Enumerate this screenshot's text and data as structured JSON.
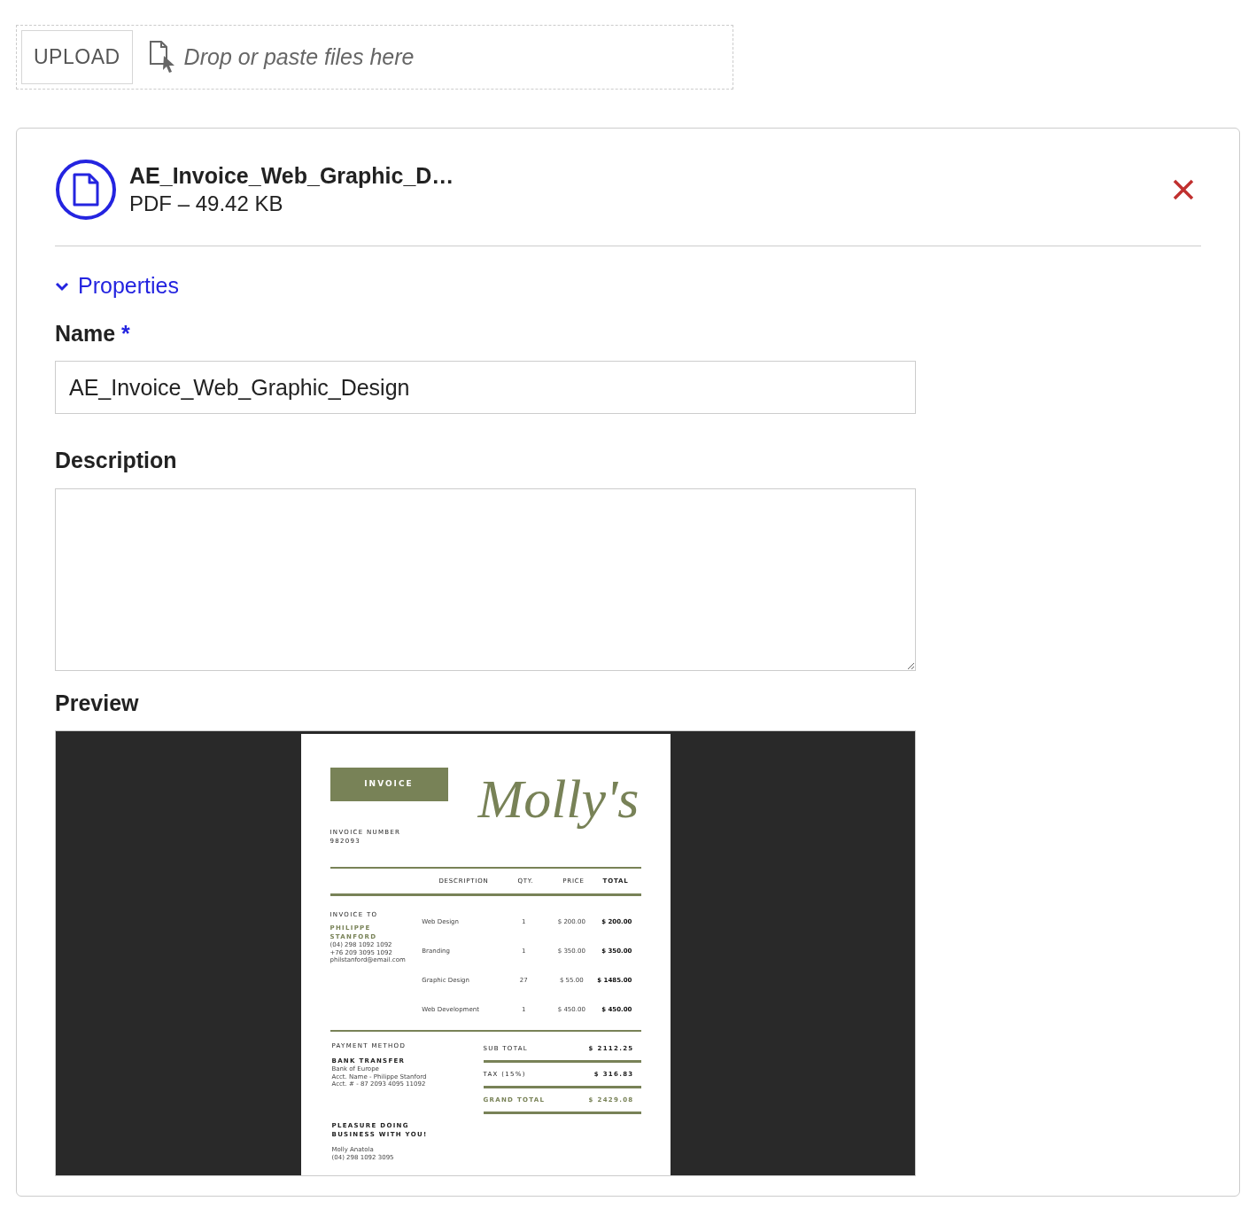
{
  "upload": {
    "button": "UPLOAD",
    "hint": "Drop or paste files here"
  },
  "file": {
    "name": "AE_Invoice_Web_Graphic_D…",
    "meta": "PDF – 49.42 KB"
  },
  "properties": {
    "label": "Properties",
    "expanded": true
  },
  "fields": [
    {
      "kind": "input",
      "label": "Name",
      "required_mark": "*",
      "value": "AE_Invoice_Web_Graphic_Design"
    },
    {
      "kind": "textarea",
      "label": "Description"
    }
  ],
  "preview": {
    "label": "Preview",
    "document": {
      "banner": "INVOICE",
      "logo": "Molly's",
      "number_label": "INVOICE NUMBER",
      "number": "982093",
      "columns": [
        "DESCRIPTION",
        "QTY.",
        "PRICE",
        "TOTAL"
      ],
      "bill_to_label": "INVOICE TO",
      "client_name": "PHILIPPE STANFORD",
      "client_lines": [
        "(04) 298 1092 1092",
        "+76 209 3095 1092",
        "philstanford@email.com"
      ],
      "rows": [
        {
          "description": "Web Design",
          "qty": "1",
          "price": "$ 200.00",
          "total": "$ 200.00"
        },
        {
          "description": "Branding",
          "qty": "1",
          "price": "$ 350.00",
          "total": "$ 350.00"
        },
        {
          "description": "Graphic Design",
          "qty": "27",
          "price": "$ 55.00",
          "total": "$ 1485.00"
        },
        {
          "description": "Web Development",
          "qty": "1",
          "price": "$ 450.00",
          "total": "$ 450.00"
        }
      ],
      "payment_label": "PAYMENT METHOD",
      "payment_method": "BANK TRANSFER",
      "payment_lines": [
        "Bank of Europe",
        "Acct. Name - Philippe Stanford",
        "Acct. # - 87 2093 4095 11092"
      ],
      "totals": [
        {
          "kind": "normal",
          "label": "SUB TOTAL",
          "value": "$ 2112.25"
        },
        {
          "kind": "normal",
          "label": "TAX (15%)",
          "value": "$ 316.83"
        },
        {
          "kind": "grand",
          "label": "GRAND TOTAL",
          "value": "$ 2429.08"
        }
      ],
      "closing": "PLEASURE DOING BUSINESS WITH YOU!",
      "signature_lines": [
        "Molly Anatola",
        "(04) 298 1092 3095"
      ]
    }
  }
}
